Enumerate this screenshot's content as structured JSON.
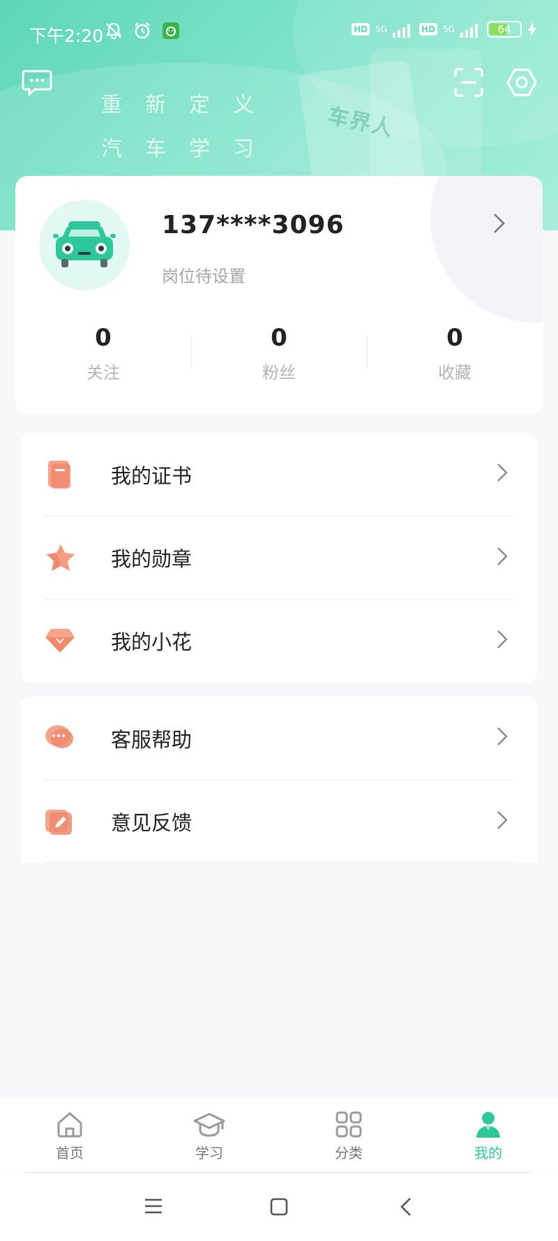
{
  "status_bar": {
    "time": "下午2:20",
    "network": "5G",
    "hd": "HD",
    "battery": "64",
    "battery_level": 0.64
  },
  "banner": {
    "slogan_line1": "重新定义",
    "slogan_line2": "汽车学习",
    "brand_watermark": "车界人"
  },
  "profile": {
    "username": "137****3096",
    "position": "岗位待设置",
    "stats": [
      {
        "value": "0",
        "label": "关注"
      },
      {
        "value": "0",
        "label": "粉丝"
      },
      {
        "value": "0",
        "label": "收藏"
      }
    ]
  },
  "menu_group_1": [
    {
      "label": "我的证书",
      "icon": "certificate-icon"
    },
    {
      "label": "我的勋章",
      "icon": "medal-icon"
    },
    {
      "label": "我的小花",
      "icon": "flower-icon"
    }
  ],
  "menu_group_2": [
    {
      "label": "客服帮助",
      "icon": "chat-bubble-icon"
    },
    {
      "label": "意见反馈",
      "icon": "feedback-icon"
    }
  ],
  "tabbar": {
    "tabs": [
      {
        "label": "首页",
        "icon": "home-icon"
      },
      {
        "label": "学习",
        "icon": "graduation-cap-icon"
      },
      {
        "label": "分类",
        "icon": "grid-icon"
      },
      {
        "label": "我的",
        "icon": "user-icon"
      }
    ],
    "active": "我的"
  },
  "colors": {
    "accent": "#2ec79c",
    "banner": "#6fdcc1",
    "menu_icon": "#f08a6e"
  }
}
